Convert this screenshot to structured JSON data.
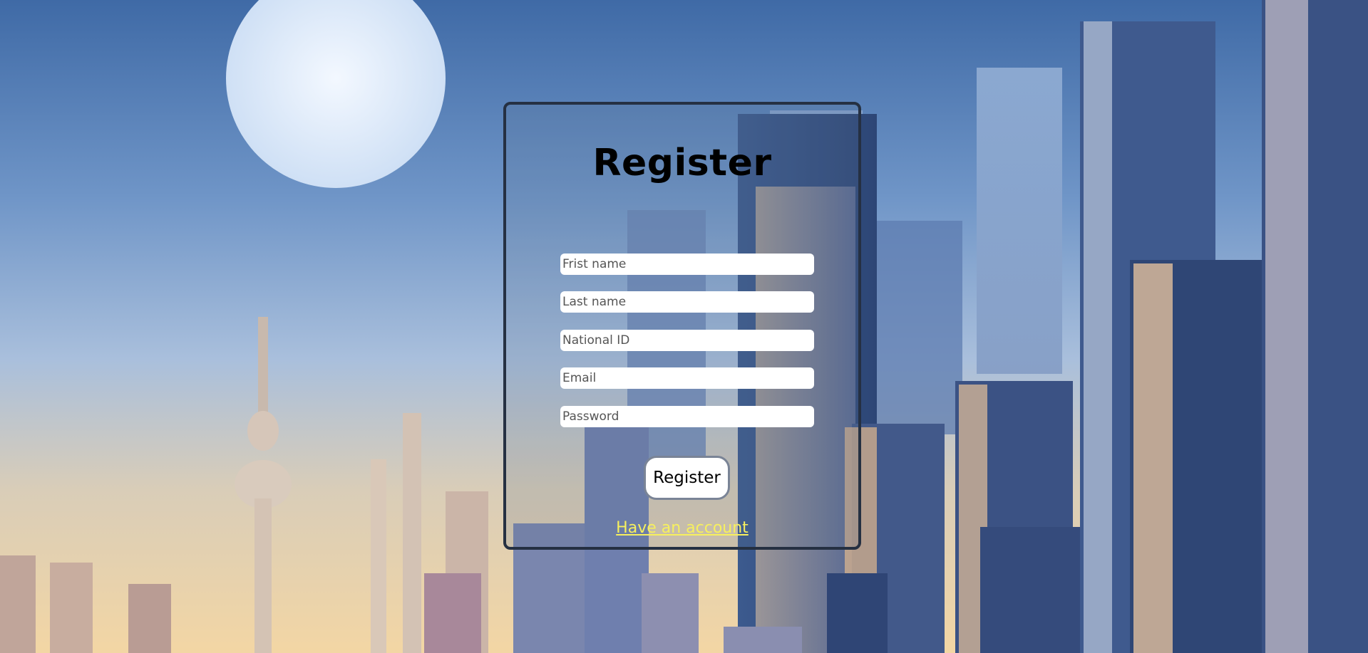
{
  "form": {
    "title": "Register",
    "fields": [
      {
        "placeholder": "Frist name",
        "value": ""
      },
      {
        "placeholder": "Last name",
        "value": ""
      },
      {
        "placeholder": "National ID",
        "value": ""
      },
      {
        "placeholder": "Email",
        "value": ""
      },
      {
        "placeholder": "Password",
        "value": ""
      }
    ],
    "submit_label": "Register",
    "login_link": "Have an account"
  },
  "colors": {
    "link": "#f7f05e",
    "card_border": "#253042",
    "sky_top": "#3f6aa6",
    "horizon": "#f3d6a4"
  }
}
